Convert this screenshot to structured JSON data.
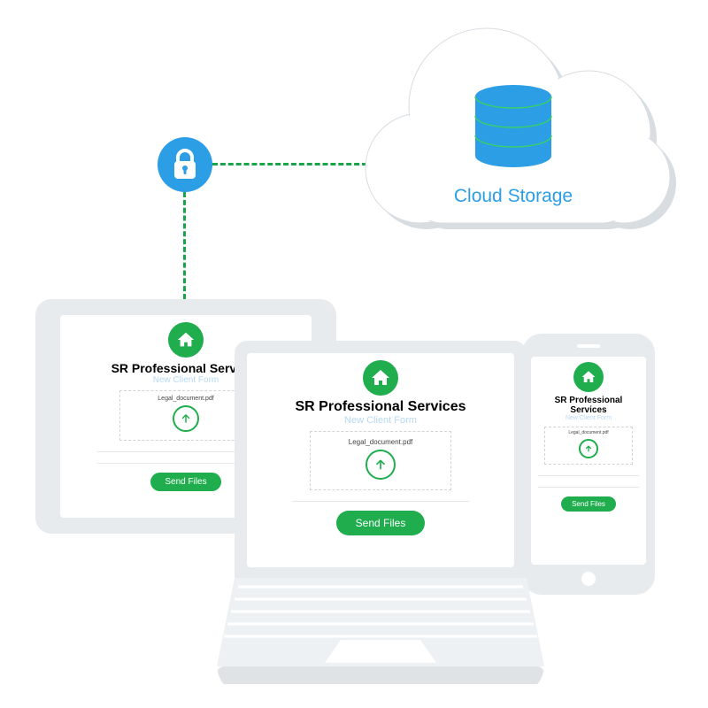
{
  "cloud": {
    "label": "Cloud Storage"
  },
  "form": {
    "company": "SR Professional Services",
    "subtitle": "New Client Form",
    "file_name": "Legal_document.pdf",
    "send_label": "Send Files"
  },
  "icons": {
    "lock": "lock-icon",
    "database": "database-icon",
    "home": "home-icon",
    "upload": "upload-arrow-icon"
  },
  "colors": {
    "blue": "#2b9ee6",
    "green": "#1fad4e",
    "dash": "#18a54a",
    "device": "#e7ebee"
  }
}
